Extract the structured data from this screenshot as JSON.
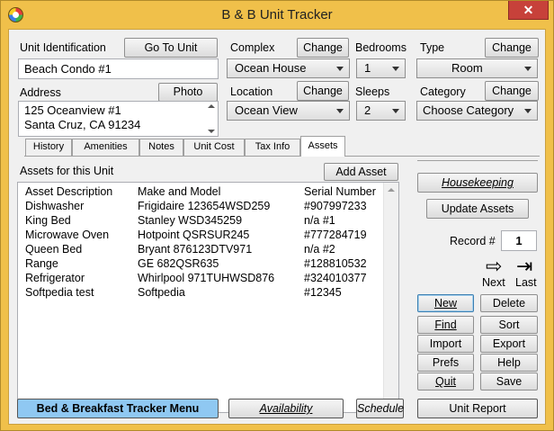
{
  "window": {
    "title": "B & B Unit Tracker",
    "close_glyph": "✕"
  },
  "unit": {
    "label": "Unit Identification",
    "value": "Beach Condo #1",
    "goto_label": "Go To Unit",
    "address_label": "Address",
    "address_line1": "125 Oceanview #1",
    "address_line2": "Santa Cruz, CA 91234",
    "photo_label": "Photo"
  },
  "complex": {
    "label": "Complex",
    "change_label": "Change",
    "value": "Ocean House"
  },
  "location": {
    "label": "Location",
    "change_label": "Change",
    "value": "Ocean View"
  },
  "bedrooms": {
    "label": "Bedrooms",
    "value": "1"
  },
  "sleeps": {
    "label": "Sleeps",
    "value": "2"
  },
  "type": {
    "label": "Type",
    "change_label": "Change",
    "value": "Room"
  },
  "category": {
    "label": "Category",
    "change_label": "Change",
    "value": "Choose Category"
  },
  "tabs": [
    {
      "label": "History"
    },
    {
      "label": "Amenities"
    },
    {
      "label": "Notes"
    },
    {
      "label": "Unit Cost"
    },
    {
      "label": "Tax Info"
    },
    {
      "label": "Assets"
    }
  ],
  "assets": {
    "section_label": "Assets for this Unit",
    "add_label": "Add Asset",
    "headers": {
      "description": "Asset Description",
      "make": "Make and Model",
      "serial": "Serial Number"
    },
    "rows": [
      {
        "description": "Dishwasher",
        "make": "Frigidaire 123654WSD259",
        "serial": "#907997233"
      },
      {
        "description": "King Bed",
        "make": "Stanley WSD345259",
        "serial": "n/a #1"
      },
      {
        "description": "Microwave Oven",
        "make": "Hotpoint QSRSUR245",
        "serial": "#777284719"
      },
      {
        "description": "Queen Bed",
        "make": "Bryant 876123DTV971",
        "serial": "n/a #2"
      },
      {
        "description": "Range",
        "make": "GE 682QSR635",
        "serial": "#128810532"
      },
      {
        "description": "Refrigerator",
        "make": "Whirlpool 971TUHWSD876",
        "serial": "#324010377"
      },
      {
        "description": "Softpedia test",
        "make": "Softpedia",
        "serial": "#12345"
      }
    ]
  },
  "right": {
    "housekeeping": "Housekeeping",
    "update_assets": "Update Assets",
    "record_label": "Record #",
    "record_value": "1",
    "next_label": "Next",
    "last_label": "Last",
    "new": "New",
    "delete": "Delete",
    "find": "Find",
    "sort": "Sort",
    "import": "Import",
    "export": "Export",
    "prefs": "Prefs",
    "help": "Help",
    "quit": "Quit",
    "save": "Save"
  },
  "bottom": {
    "menu": "Bed & Breakfast Tracker Menu",
    "availability": "Availability",
    "schedule": "Schedule",
    "unit_report": "Unit Report"
  },
  "colors": {
    "frame": "#f0c04a",
    "menu_button": "#8fc8f2",
    "close": "#c7413a"
  }
}
